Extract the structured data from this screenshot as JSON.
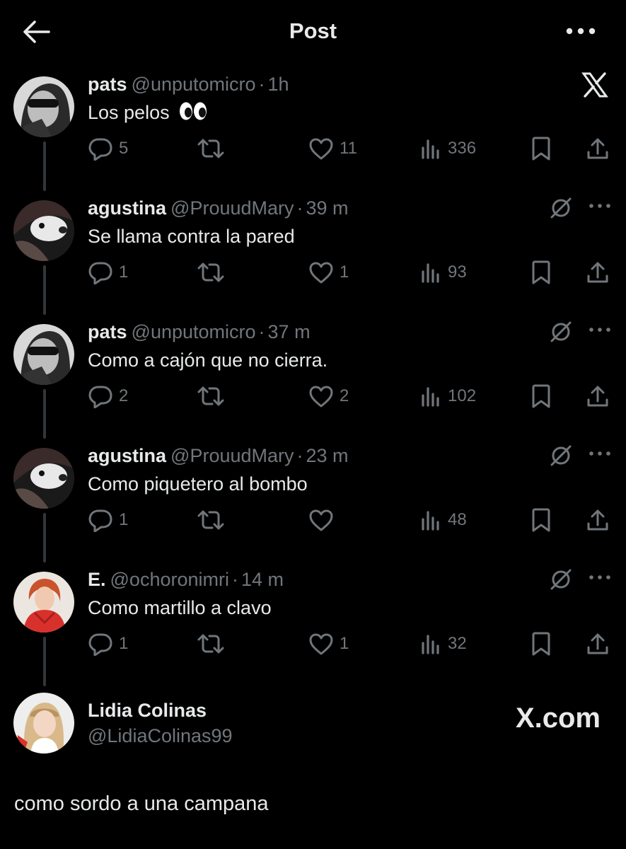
{
  "header": {
    "title": "Post",
    "back_icon": "arrow-left-icon",
    "more_icon": "more-dots-icon"
  },
  "tweets": [
    {
      "name": "pats",
      "handle": "@unputomicro",
      "dot": "·",
      "time": "1h",
      "text": "Los pelos",
      "emoji": "eyes-emoji",
      "replies": "5",
      "retweets": "",
      "likes": "11",
      "views": "336",
      "corner": "x-logo-icon"
    },
    {
      "name": "agustina",
      "handle": "@ProuudMary",
      "dot": "·",
      "time": "39 m",
      "text": "Se llama contra la pared",
      "replies": "1",
      "retweets": "",
      "likes": "1",
      "views": "93",
      "corner": "grok-icon"
    },
    {
      "name": "pats",
      "handle": "@unputomicro",
      "dot": "·",
      "time": "37 m",
      "text": "Como a cajón que no cierra.",
      "replies": "2",
      "retweets": "",
      "likes": "2",
      "views": "102",
      "corner": "grok-icon"
    },
    {
      "name": "agustina",
      "handle": "@ProuudMary",
      "dot": "·",
      "time": "23 m",
      "text": "Como piquetero al bombo",
      "replies": "1",
      "retweets": "",
      "likes": "",
      "views": "48",
      "corner": "grok-icon"
    },
    {
      "name": "E.",
      "handle": "@ochoronimri",
      "dot": "·",
      "time": "14 m",
      "text": "Como martillo a clavo",
      "replies": "1",
      "retweets": "",
      "likes": "1",
      "views": "32",
      "corner": "grok-icon"
    }
  ],
  "reply": {
    "name": "Lidia Colinas",
    "handle": "@LidiaColinas99",
    "brand": "X.com",
    "text": "como sordo a una campana"
  },
  "colors": {
    "background": "#000000",
    "primary_text": "#e7e9ea",
    "secondary_text": "#71767b",
    "thread_line": "#333639"
  }
}
